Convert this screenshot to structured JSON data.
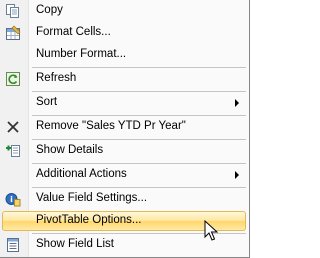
{
  "menu": {
    "items": [
      {
        "label": "Copy",
        "icon": "copy-icon"
      },
      {
        "label": "Format Cells...",
        "icon": "format-cells-icon"
      },
      {
        "label": "Number Format...",
        "icon": ""
      },
      {
        "label": "Refresh",
        "icon": "refresh-icon"
      },
      {
        "label": "Sort",
        "icon": "",
        "submenu": true
      },
      {
        "label": "Remove \"Sales YTD Pr Year\"",
        "icon": "remove-x-icon"
      },
      {
        "label": "Show Details",
        "icon": "show-details-icon"
      },
      {
        "label": "Additional Actions",
        "icon": "",
        "submenu": true
      },
      {
        "label": "Value Field Settings...",
        "icon": "value-field-settings-icon"
      },
      {
        "label": "PivotTable Options...",
        "icon": "",
        "highlighted": true
      },
      {
        "label": "Show Field List",
        "icon": "field-list-icon"
      }
    ]
  },
  "colors": {
    "highlight_border": "#e3b95a",
    "highlight_fill": "#ffe7a2",
    "menu_bg": "#fafafa",
    "gutter_bg": "#f1f1f1"
  }
}
